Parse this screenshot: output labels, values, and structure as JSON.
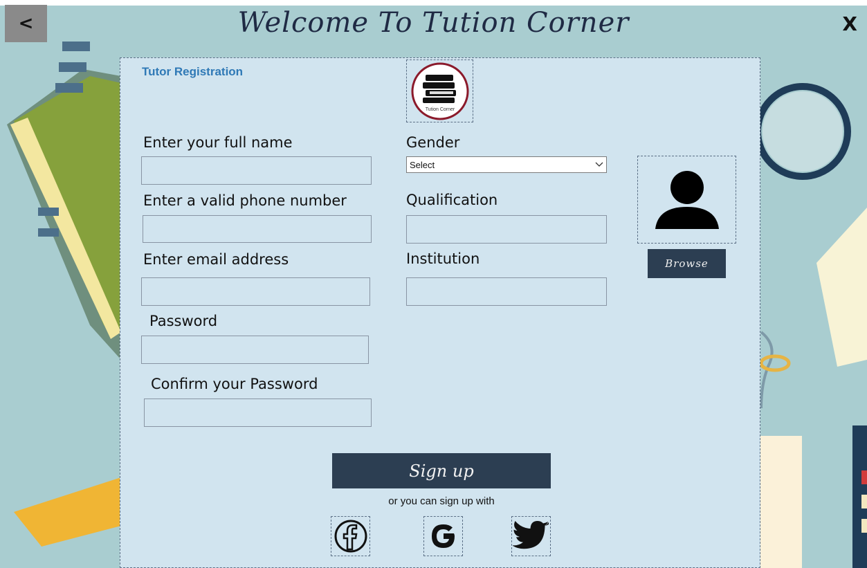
{
  "header": {
    "title": "Welcome To Tution Corner",
    "back_label": "<",
    "close_label": "X"
  },
  "form": {
    "heading": "Tutor Registration",
    "logo_text": "Tution Corner",
    "full_name_label": "Enter your full name",
    "phone_label": "Enter a valid phone number",
    "email_label": "Enter email address",
    "password_label": "Password",
    "confirm_password_label": "Confirm your Password",
    "gender_label": "Gender",
    "gender_selected": "Select",
    "qualification_label": "Qualification",
    "institution_label": "Institution",
    "browse_label": "Browse",
    "signup_label": "Sign up",
    "alt_signup_text": "or you can sign up with"
  },
  "icons": {
    "back": "chevron-left-icon",
    "close": "close-icon",
    "logo": "books-logo-icon",
    "avatar": "user-icon",
    "facebook": "facebook-icon",
    "google": "google-icon",
    "twitter": "twitter-icon",
    "dropdown": "chevron-down-icon"
  },
  "colors": {
    "panel": "#d1e4ef",
    "button": "#2c3e52",
    "heading": "#2f79b6",
    "background": "#a9cdd0"
  }
}
